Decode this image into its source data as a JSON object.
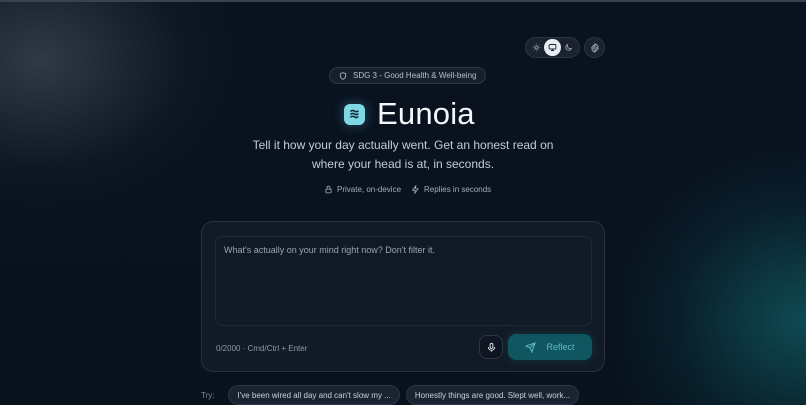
{
  "theme_controls": {
    "options": [
      {
        "name": "light",
        "icon": "sun-icon"
      },
      {
        "name": "system",
        "icon": "monitor-icon",
        "active": true
      },
      {
        "name": "dark",
        "icon": "moon-icon"
      }
    ],
    "settings_icon": "gear-icon"
  },
  "badge": {
    "icon": "shield-icon",
    "text": "SDG 3 - Good Health & Well-being"
  },
  "hero": {
    "logo_icon": "waves-icon",
    "title": "Eunoia",
    "tagline": "Tell it how your day actually went. Get an honest read on where your head is at, in seconds."
  },
  "features": [
    {
      "icon": "lock-icon",
      "label": "Private, on-device"
    },
    {
      "icon": "bolt-icon",
      "label": "Replies in seconds"
    }
  ],
  "composer": {
    "placeholder": "What's actually on your mind right now? Don't filter it.",
    "counter": "0/2000 · Cmd/Ctrl + Enter",
    "mic_icon": "microphone-icon",
    "submit_label": "Reflect",
    "submit_icon": "send-icon"
  },
  "suggestions": {
    "label": "Try:",
    "chips": [
      "I've been wired all day and can't slow my ...",
      "Honestly things are good. Slept well, work..."
    ]
  },
  "colors": {
    "accent": "#7fd8e6",
    "button_bg": "#0f5660",
    "button_text": "#5fb9c4",
    "background": "#08111c"
  }
}
